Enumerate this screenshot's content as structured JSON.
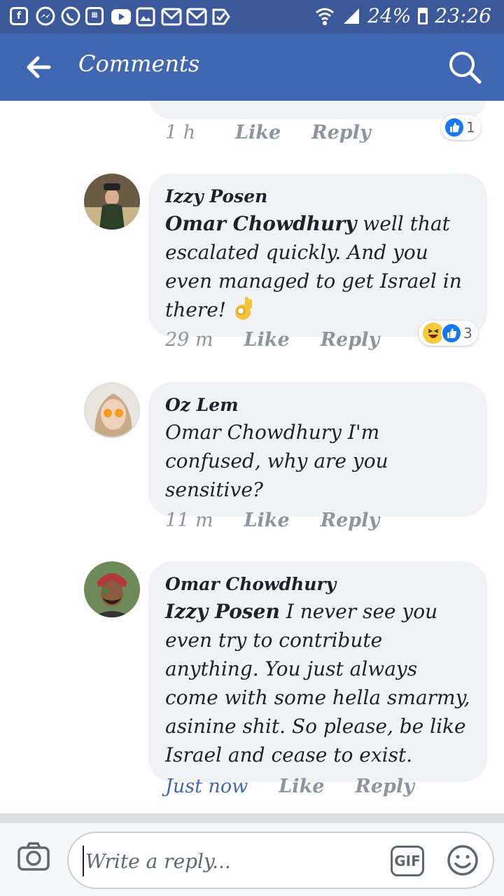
{
  "status_bar": {
    "battery": "24%",
    "time": "23:26",
    "icons": [
      "facebook-icon",
      "messenger-icon",
      "whatsapp-icon",
      "calendar-icon",
      "youtube-icon",
      "gallery-icon",
      "gmail-icon",
      "gmail-icon",
      "check-icon"
    ]
  },
  "app_bar": {
    "title": "Comments"
  },
  "previous_comment": {
    "time": "1 h",
    "like_label": "Like",
    "reply_label": "Reply",
    "reaction_count": "1"
  },
  "comments": [
    {
      "author": "Izzy Posen",
      "mention": "Omar Chowdhury",
      "text": " well that escalated quickly. And you even managed to get Israel in there! ",
      "emoji": "ok-hand",
      "time": "29 m",
      "like_label": "Like",
      "reply_label": "Reply",
      "reaction_count": "3",
      "reactions": [
        "haha",
        "like"
      ]
    },
    {
      "author": "Oz Lem",
      "mention": "Omar Chowdhury",
      "text": " I'm confused, why are you sensitive?",
      "time": "11 m",
      "like_label": "Like",
      "reply_label": "Reply"
    },
    {
      "author": "Omar Chowdhury",
      "mention": "Izzy Posen",
      "text": " I never see you even try to contribute anything. You just always come with some hella smarmy, asinine shit. So please, be like Israel and cease to exist.",
      "time": "Just now",
      "like_label": "Like",
      "reply_label": "Reply"
    }
  ],
  "composer": {
    "placeholder": "Write a reply...",
    "gif_label": "GIF"
  },
  "colors": {
    "status_bar": "#3b5998",
    "app_bar": "#4267b2",
    "bubble": "#f1f2f6",
    "like_blue": "#1877f2"
  }
}
